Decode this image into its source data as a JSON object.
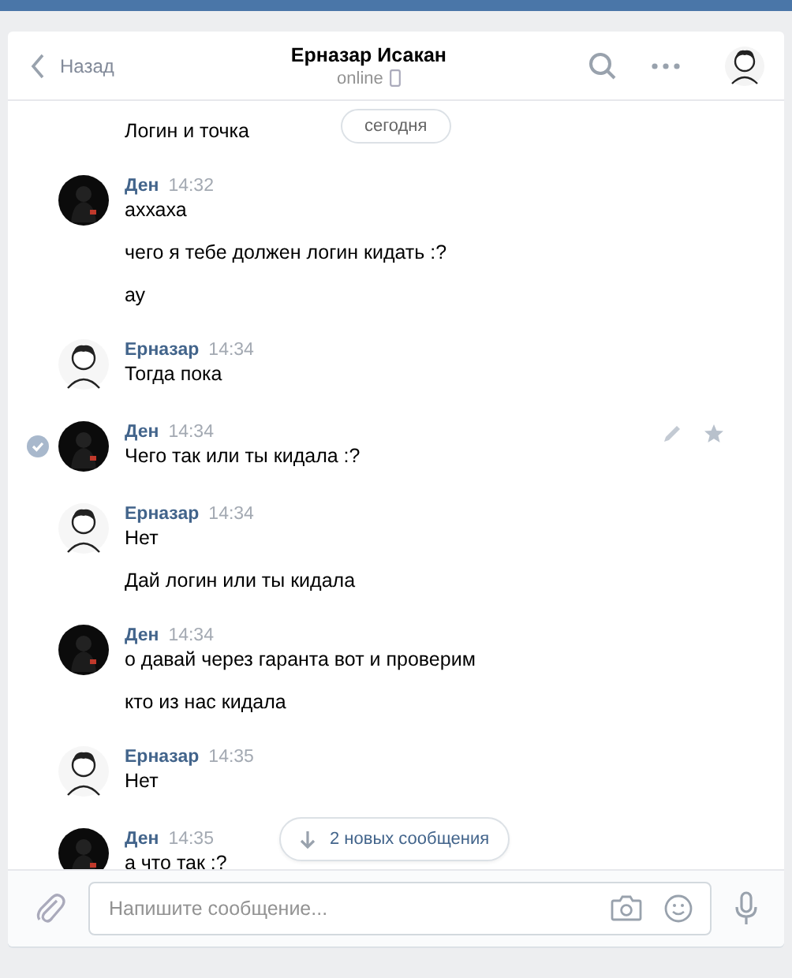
{
  "header": {
    "back": "Назад",
    "title": "Ерназар Исакан",
    "status": "online"
  },
  "date_pill": "сегодня",
  "messages": [
    {
      "kind": "continuation",
      "selected": false,
      "lines": [
        "Логин и точка"
      ]
    },
    {
      "kind": "dark",
      "author": "Ден",
      "time": "14:32",
      "selected": false,
      "lines": [
        "аххаха",
        "чего я тебе должен логин кидать :?",
        "ау"
      ]
    },
    {
      "kind": "light",
      "author": "Ерназар",
      "time": "14:34",
      "selected": false,
      "lines": [
        "Тогда пока"
      ]
    },
    {
      "kind": "dark",
      "author": "Ден",
      "time": "14:34",
      "selected": true,
      "lines": [
        "Чего так или ты кидала :?"
      ]
    },
    {
      "kind": "light",
      "author": "Ерназар",
      "time": "14:34",
      "selected": false,
      "lines": [
        "Нет",
        "Дай логин или ты кидала"
      ]
    },
    {
      "kind": "dark",
      "author": "Ден",
      "time": "14:34",
      "selected": false,
      "lines": [
        "о давай через гаранта вот и проверим",
        "кто из нас кидала"
      ]
    },
    {
      "kind": "light",
      "author": "Ерназар",
      "time": "14:35",
      "selected": false,
      "lines": [
        "Нет"
      ]
    },
    {
      "kind": "dark",
      "author": "Ден",
      "time": "14:35",
      "selected": false,
      "lines": [
        "а что так :?"
      ]
    }
  ],
  "new_messages": "2 новых сообщения",
  "composer": {
    "placeholder": "Напишите сообщение..."
  }
}
